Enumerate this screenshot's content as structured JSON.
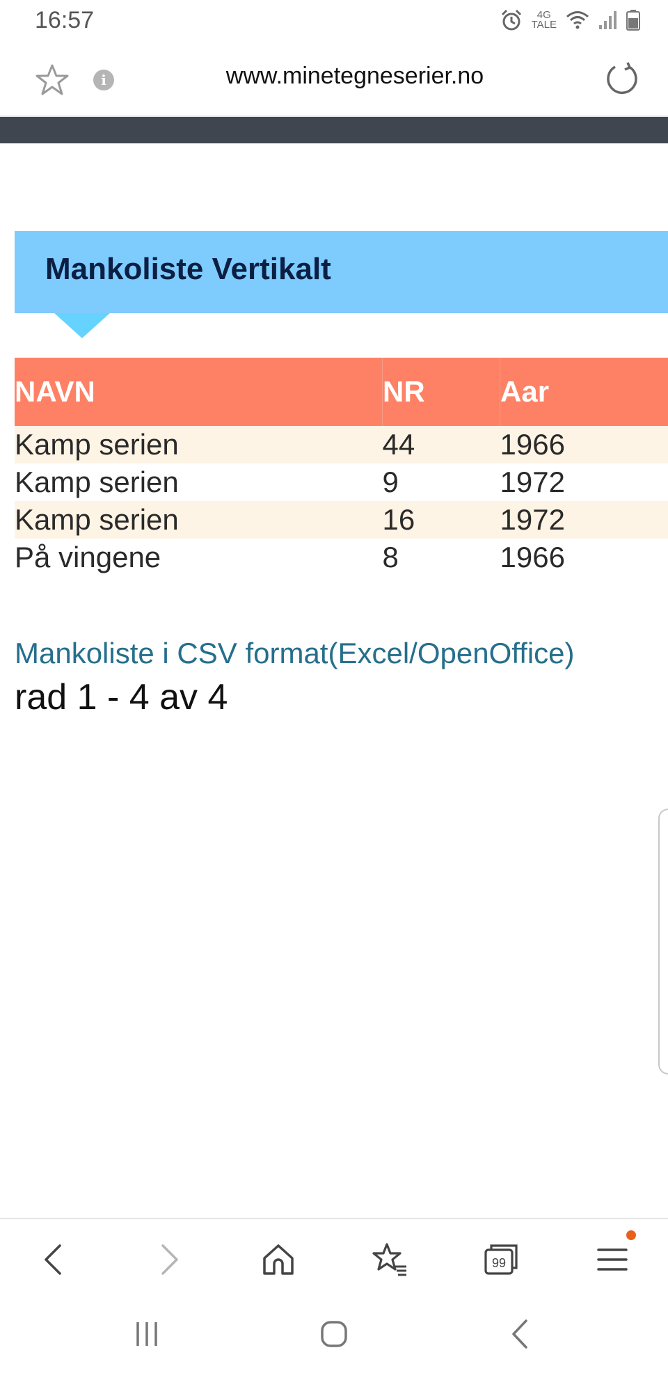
{
  "status_bar": {
    "time": "16:57",
    "network_top": "4G",
    "network_bottom": "TALE",
    "icons": [
      "alarm-icon",
      "network-4g-tale",
      "wifi-icon",
      "signal-icon",
      "battery-icon"
    ]
  },
  "browser": {
    "url": "www.minetegneserier.no",
    "icons": [
      "star-icon",
      "info-icon",
      "reload-icon"
    ]
  },
  "page": {
    "heading": "Mankoliste Vertikalt",
    "table": {
      "headers": [
        "NAVN",
        "NR",
        "Aar"
      ],
      "rows": [
        [
          "Kamp serien",
          "44",
          "1966"
        ],
        [
          "Kamp serien",
          "9",
          "1972"
        ],
        [
          "Kamp serien",
          "16",
          "1972"
        ],
        [
          "På vingene",
          "8",
          "1966"
        ]
      ]
    },
    "csv_link": "Mankoliste i CSV format(Excel/OpenOffice)",
    "row_count": "rad 1 - 4 av 4"
  },
  "toolbar": {
    "icons": [
      "back-icon",
      "forward-icon",
      "home-icon",
      "bookmarks-icon",
      "tabs-icon",
      "menu-icon"
    ],
    "tabs_count": "99"
  },
  "nav_bar": {
    "icons": [
      "recent-apps-icon",
      "home-nav-icon",
      "back-nav-icon"
    ]
  },
  "colors": {
    "heading_bg": "#7ecbfd",
    "table_header_bg": "#fe8165",
    "row_alt_bg": "#fdf4e5",
    "link_color": "#256f8c",
    "dark_band": "#3f4650",
    "notification_dot": "#e8611a"
  }
}
